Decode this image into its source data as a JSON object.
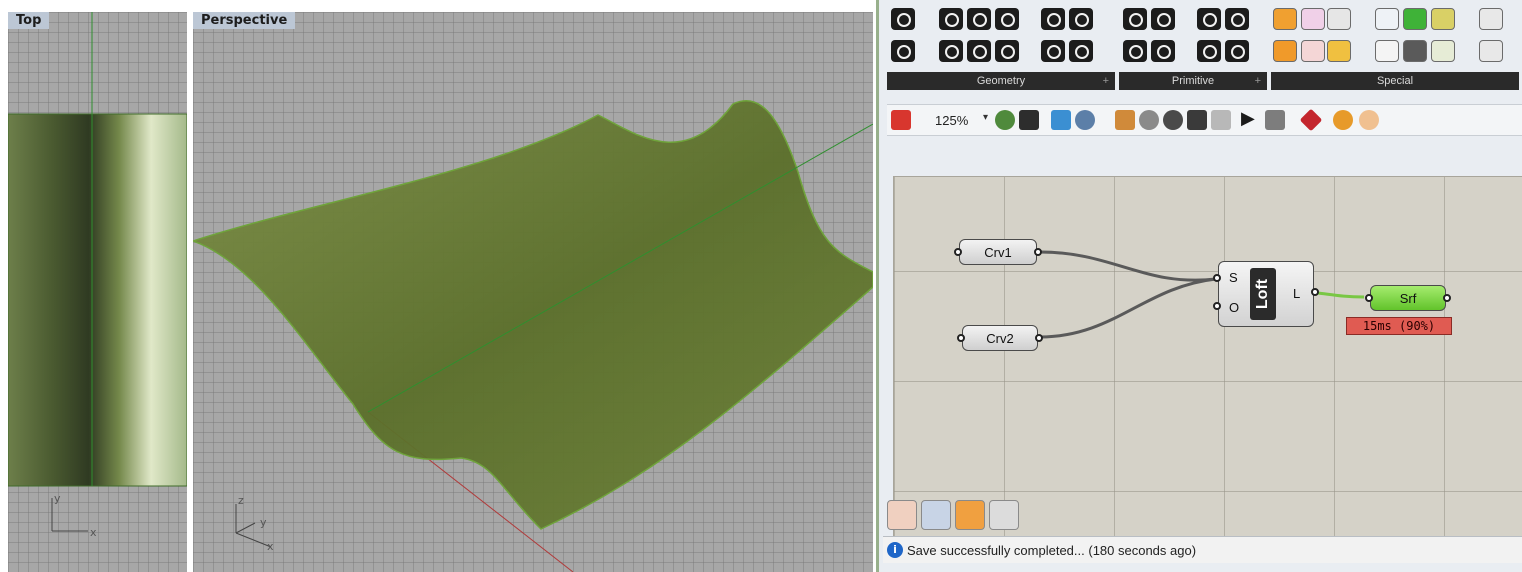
{
  "viewports": {
    "top_label": "Top",
    "perspective_label": "Perspective",
    "axis": {
      "y": "y",
      "x": "x",
      "z": "z"
    }
  },
  "toolbar": {
    "categories": [
      "Geometry",
      "Primitive",
      "Special"
    ],
    "zoom": "125%"
  },
  "canvas": {
    "components": {
      "crv1": "Crv1",
      "crv2": "Crv2",
      "loft_name": "Loft",
      "loft_in_s": "S",
      "loft_in_o": "O",
      "loft_out": "L",
      "srf": "Srf"
    },
    "profiler": "15ms (90%)"
  },
  "status": {
    "message": "Save successfully completed... (180 seconds ago)"
  },
  "colors": {
    "surface": "#6a8036",
    "accent_green": "#62c32b",
    "profiler_red": "#e05b52"
  }
}
